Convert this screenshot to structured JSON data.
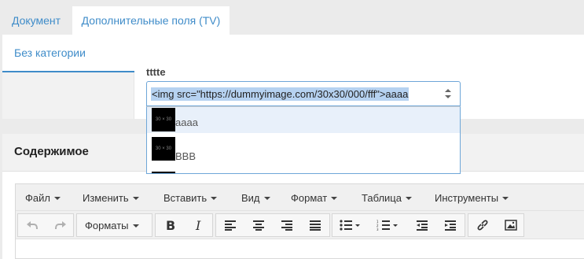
{
  "top_tabs": [
    {
      "label": "Документ",
      "active": false
    },
    {
      "label": "Дополнительные поля (TV)",
      "active": true
    }
  ],
  "category_tab": {
    "label": "Без категории"
  },
  "tv": {
    "label": "tttte",
    "selected_value": "<img src=\"https://dummyimage.com/30x30/000/fff\">aaaa",
    "options": [
      {
        "thumb_text": "30 × 30",
        "label": "aaaa",
        "highlighted": true
      },
      {
        "thumb_text": "30 × 30",
        "label": "BBB",
        "highlighted": false
      }
    ]
  },
  "content": {
    "title": "Содержимое"
  },
  "editor": {
    "menu": [
      "Файл",
      "Изменить",
      "Вставить",
      "Вид",
      "Формат",
      "Таблица",
      "Инструменты"
    ],
    "formats_label": "Форматы",
    "icons": [
      "undo-icon",
      "redo-icon",
      "bold-icon",
      "italic-icon",
      "align-left-icon",
      "align-center-icon",
      "align-right-icon",
      "align-justify-icon",
      "bullet-list-icon",
      "numbered-list-icon",
      "outdent-icon",
      "indent-icon",
      "link-icon",
      "image-icon"
    ]
  },
  "colors": {
    "accent": "#3f8cc9",
    "panel_bg": "#ffffff",
    "page_bg": "#ebebeb",
    "selection": "#b6d2f1"
  }
}
